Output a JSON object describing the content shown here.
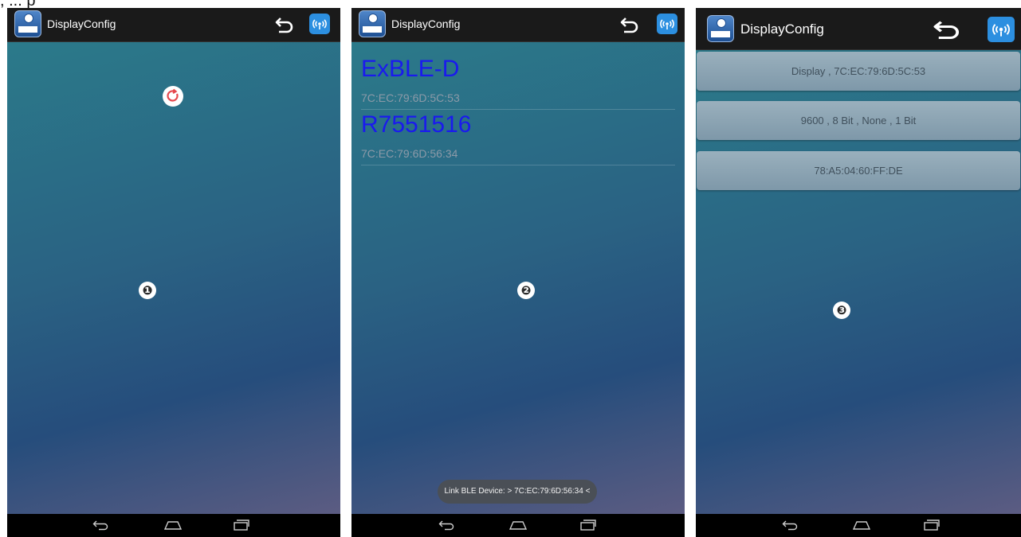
{
  "caption": ", ... p",
  "screens": [
    {
      "app_title": "DisplayConfig",
      "marker": "❶"
    },
    {
      "app_title": "DisplayConfig",
      "devices": [
        {
          "name": "ExBLE-D",
          "mac": "7C:EC:79:6D:5C:53"
        },
        {
          "name": "R7551516",
          "mac": "7C:EC:79:6D:56:34"
        }
      ],
      "toast": "Link BLE Device: > 7C:EC:79:6D:56:34 <",
      "marker": "❷"
    },
    {
      "app_title": "DisplayConfig",
      "buttons": [
        "Display , 7C:EC:79:6D:5C:53",
        "9600 , 8 Bit , None , 1 Bit",
        "78:A5:04:60:FF:DE"
      ],
      "marker": "❸"
    }
  ],
  "icons": {
    "app": "app-logo-icon",
    "back": "back-arrow-icon",
    "ble": "bluetooth-signal-icon",
    "refresh": "refresh-icon",
    "nav_back": "nav-back-icon",
    "nav_home": "nav-home-icon",
    "nav_recent": "nav-recent-apps-icon"
  },
  "colors": {
    "actionbar": "#1a1a1a",
    "device_name": "#1a1aee",
    "device_mac": "#8c9aa8",
    "ble_icon": "#2c8fe0",
    "refresh_arrow": "#e5484d"
  }
}
